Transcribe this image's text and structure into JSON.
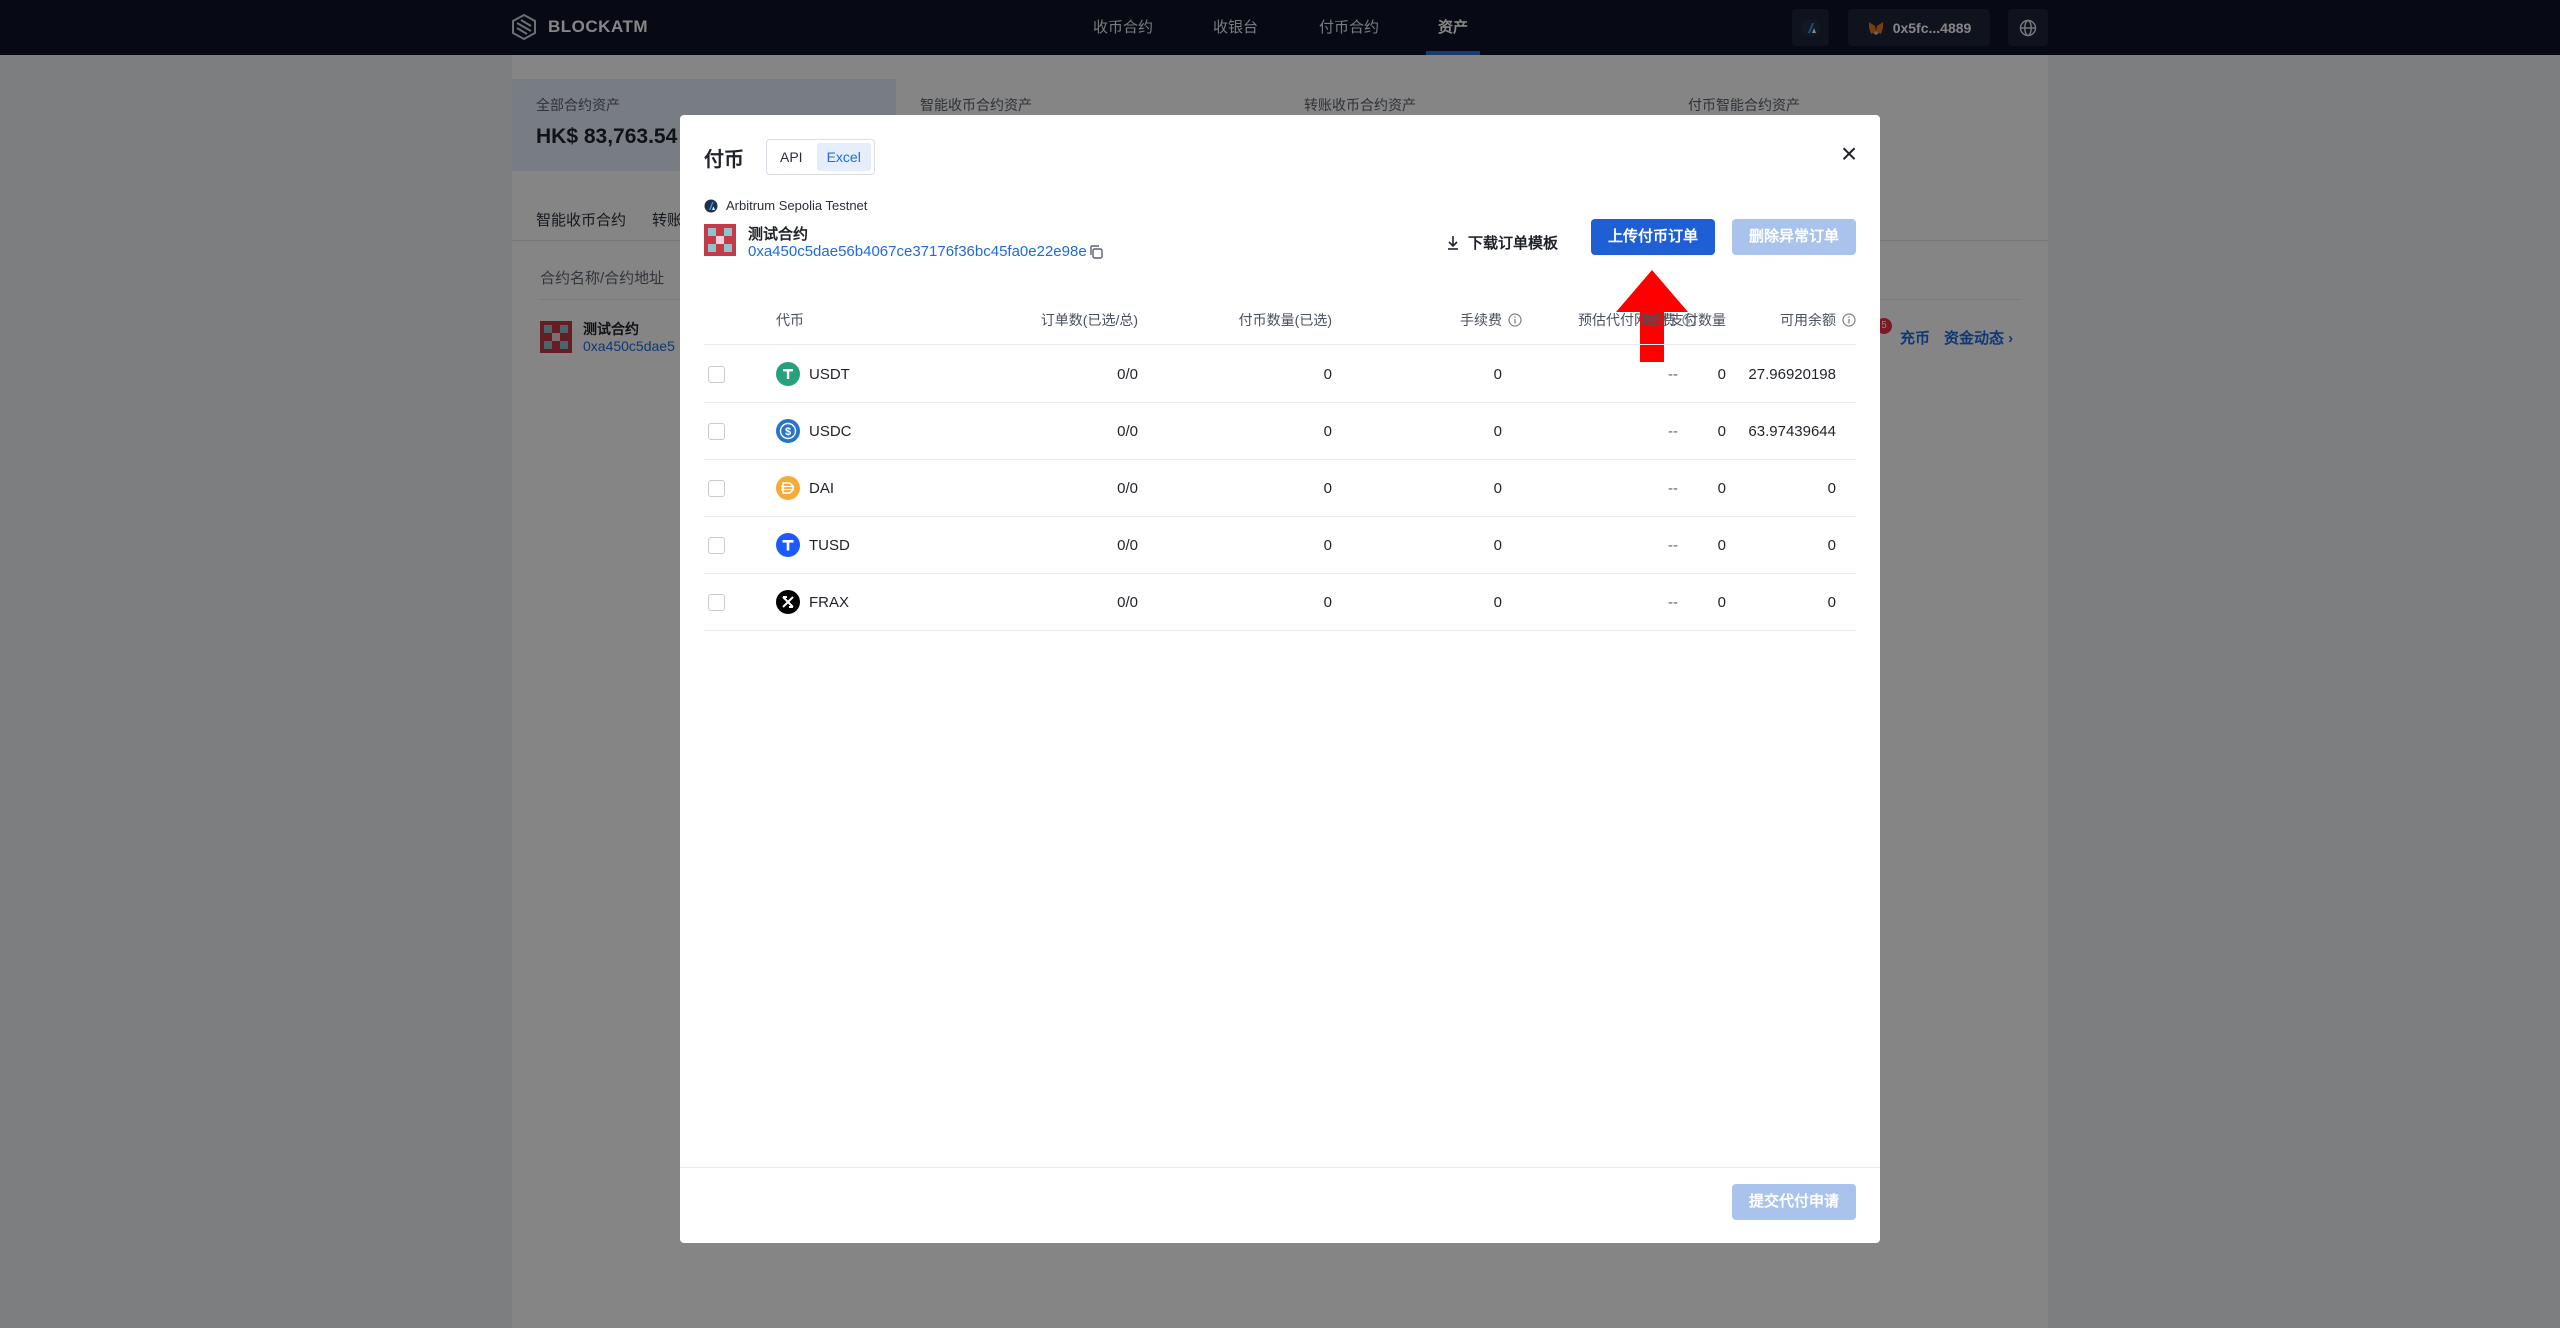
{
  "nav": {
    "brand": "BLOCKATM",
    "items": [
      "收币合约",
      "收银台",
      "付币合约",
      "资产"
    ],
    "wallet": "0x5fc...4889"
  },
  "page": {
    "stats": [
      {
        "label": "全部合约资产",
        "value": "HK$ 83,763.54"
      },
      {
        "label": "智能收币合约资产",
        "value": ""
      },
      {
        "label": "转账收币合约资产",
        "value": ""
      },
      {
        "label": "付币智能合约资产",
        "value": ""
      }
    ],
    "tabs": [
      "智能收币合约",
      "转账"
    ],
    "column_label": "合约名称/合约地址",
    "row_name": "测试合约",
    "row_addr": "0xa450c5dae5",
    "badge": "5",
    "link_recharge": "充币",
    "link_funds": "资金动态 ›"
  },
  "modal": {
    "title": "付币",
    "segments": [
      "API",
      "Excel"
    ],
    "active_segment": "Excel",
    "close": "×",
    "network": "Arbitrum Sepolia Testnet",
    "contract_name": "测试合约",
    "contract_address": "0xa450c5dae56b4067ce37176f36bc45fa0e22e98e",
    "btn_download": "下载订单模板",
    "btn_upload": "上传付币订单",
    "btn_delete": "删除异常订单",
    "btn_submit": "提交代付申请",
    "columns": {
      "coin": "代币",
      "orders": "订单数(已选/总)",
      "pay_amount": "付币数量(已选)",
      "fee": "手续费",
      "gas": "预估代付网络费",
      "total": "总计支付数量",
      "balance": "可用余额"
    },
    "rows": [
      {
        "coin": "USDT",
        "orders": "0/0",
        "pay_amount": "0",
        "fee": "0",
        "gas": "--",
        "total": "0",
        "balance": "27.96920198"
      },
      {
        "coin": "USDC",
        "orders": "0/0",
        "pay_amount": "0",
        "fee": "0",
        "gas": "--",
        "total": "0",
        "balance": "63.97439644"
      },
      {
        "coin": "DAI",
        "orders": "0/0",
        "pay_amount": "0",
        "fee": "0",
        "gas": "--",
        "total": "0",
        "balance": "0"
      },
      {
        "coin": "TUSD",
        "orders": "0/0",
        "pay_amount": "0",
        "fee": "0",
        "gas": "--",
        "total": "0",
        "balance": "0"
      },
      {
        "coin": "FRAX",
        "orders": "0/0",
        "pay_amount": "0",
        "fee": "0",
        "gas": "--",
        "total": "0",
        "balance": "0"
      }
    ]
  },
  "colors": {
    "primary": "#1f5fd6",
    "primary_disabled": "#a9c3ec",
    "nav_bg": "#0e1527",
    "arrow": "#ff0000"
  }
}
